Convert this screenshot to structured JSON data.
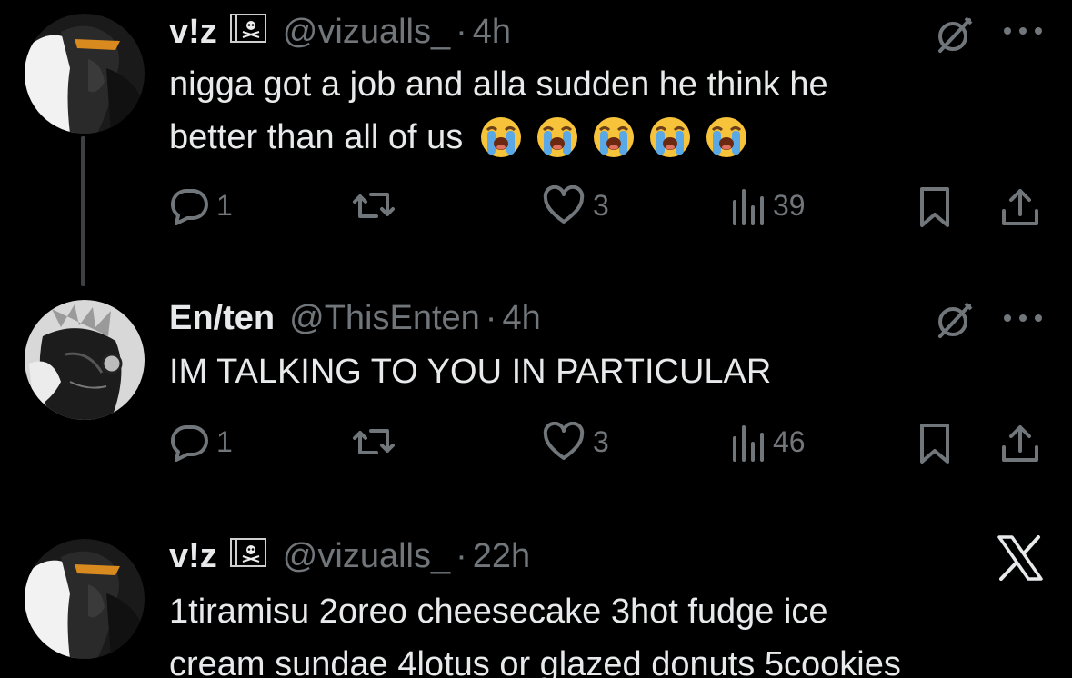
{
  "tweets": [
    {
      "name": "v!z",
      "flag": "pirate-flag",
      "handle": "@vizualls_",
      "separator": "·",
      "time": "4h",
      "text_line1": "nigga got a job and alla sudden he think he",
      "text_line2": "better than all of us",
      "emojis": [
        "loudly-crying-face",
        "loudly-crying-face",
        "loudly-crying-face",
        "loudly-crying-face",
        "loudly-crying-face"
      ],
      "reply_count": "1",
      "retweet_count": "",
      "like_count": "3",
      "view_count": "39"
    },
    {
      "name": "En/ten",
      "handle": "@ThisEnten",
      "separator": "·",
      "time": "4h",
      "text_line1": "IM TALKING TO YOU IN PARTICULAR",
      "reply_count": "1",
      "retweet_count": "",
      "like_count": "3",
      "view_count": "46"
    },
    {
      "name": "v!z",
      "flag": "pirate-flag",
      "handle": "@vizualls_",
      "separator": "·",
      "time": "22h",
      "text_line1": "1tiramisu 2oreo cheesecake 3hot fudge ice",
      "text_line2": "cream sundae 4lotus or glazed donuts 5cookies"
    }
  ],
  "icons": {
    "reply": "reply-icon",
    "retweet": "retweet-icon",
    "like": "heart-icon",
    "views": "views-icon",
    "bookmark": "bookmark-icon",
    "share": "share-icon",
    "grok": "grok-icon",
    "more": "more-icon",
    "x_logo": "x-logo-icon"
  },
  "colors": {
    "background": "#000000",
    "text": "#e7e9ea",
    "muted": "#71767b",
    "divider": "#2f3336",
    "thread_line": "#3d4144"
  }
}
